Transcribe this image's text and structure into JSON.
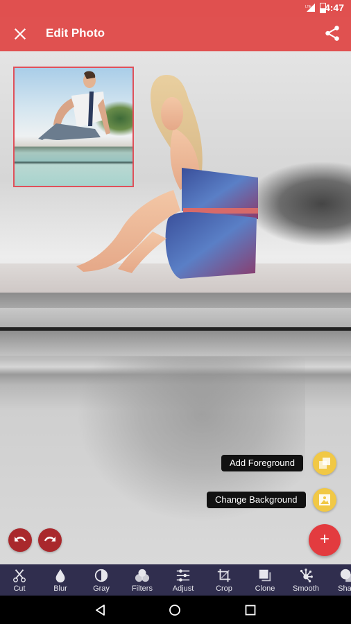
{
  "status_bar": {
    "time": "4:47",
    "network": "LTE",
    "battery_icon": "battery-charging-icon"
  },
  "app_bar": {
    "title": "Edit Photo",
    "close_icon": "close-icon",
    "share_icon": "share-icon",
    "color": "#e05150"
  },
  "canvas": {
    "foreground_thumbnail": "foreground-image-thumbnail",
    "background_image": "background-photo"
  },
  "fab_menu": {
    "items": [
      {
        "label": "Add Foreground",
        "icon": "layers-icon"
      },
      {
        "label": "Change Background",
        "icon": "image-icon"
      }
    ],
    "main_fab_label": "+",
    "accent": "#f1c845",
    "main_color": "#e33b3f"
  },
  "history": {
    "undo_icon": "undo-icon",
    "redo_icon": "redo-icon"
  },
  "toolbar": {
    "items": [
      {
        "label": "Cut",
        "icon": "scissors-icon"
      },
      {
        "label": "Blur",
        "icon": "drop-icon"
      },
      {
        "label": "Gray",
        "icon": "contrast-icon"
      },
      {
        "label": "Filters",
        "icon": "filters-icon"
      },
      {
        "label": "Adjust",
        "icon": "sliders-icon"
      },
      {
        "label": "Crop",
        "icon": "crop-icon"
      },
      {
        "label": "Clone",
        "icon": "clone-icon"
      },
      {
        "label": "Smooth",
        "icon": "smooth-icon"
      },
      {
        "label": "Shad",
        "icon": "shadow-icon"
      }
    ],
    "background": "#302e4e"
  },
  "nav_bar": {
    "back": "back-icon",
    "home": "home-icon",
    "recents": "recents-icon"
  }
}
